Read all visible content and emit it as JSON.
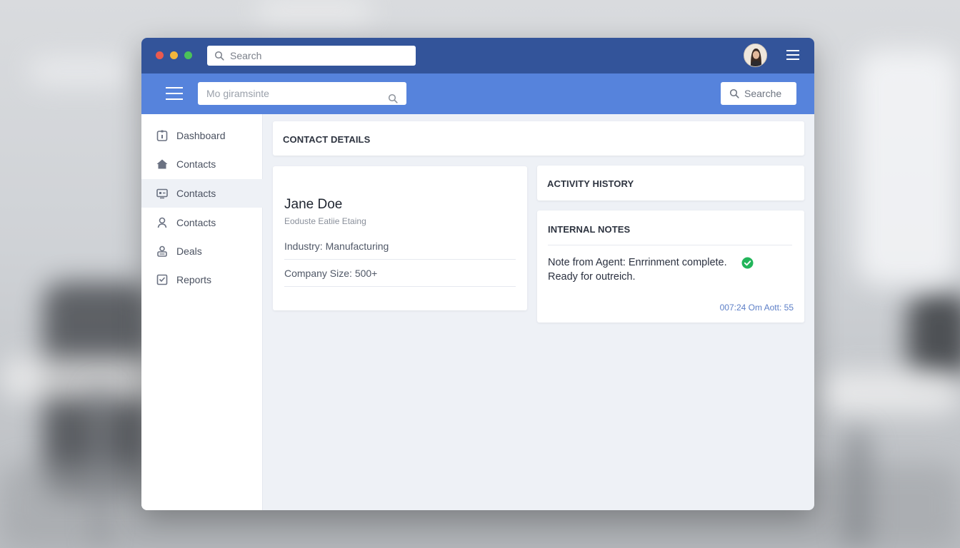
{
  "titlebar": {
    "search_placeholder": "Search",
    "avatar_icon": "user-avatar",
    "menu_icon": "hamburger-icon"
  },
  "toolbar": {
    "input_value": "Mo giramsinte",
    "search_button_label": "Searche"
  },
  "sidebar": {
    "items": [
      {
        "label": "Dashboard",
        "icon": "dashboard-icon"
      },
      {
        "label": "Contacts",
        "icon": "home-icon"
      },
      {
        "label": "Contacts",
        "icon": "id-card-icon",
        "active": true
      },
      {
        "label": "Contacts",
        "icon": "person-icon"
      },
      {
        "label": "Deals",
        "icon": "deals-icon"
      },
      {
        "label": "Reports",
        "icon": "reports-icon"
      }
    ]
  },
  "contact_details": {
    "header": "CONTACT DETAILS",
    "name": "Jane Doe",
    "subtitle": "Eoduste Eatiie Etaing",
    "industry": "Industry: Manufacturing",
    "company_size": "Company Size: 500+"
  },
  "activity": {
    "header": "ACTIVITY HISTORY"
  },
  "notes": {
    "header": "INTERNAL NOTES",
    "text": "Note from Agent: Enrrinment complete. Ready for outreich.",
    "timestamp": "007:24 Om Aott: 55"
  },
  "colors": {
    "titlebar": "#33549a",
    "toolbar": "#5683dc",
    "check": "#22b55a",
    "timestamp": "#5d7fc7"
  }
}
